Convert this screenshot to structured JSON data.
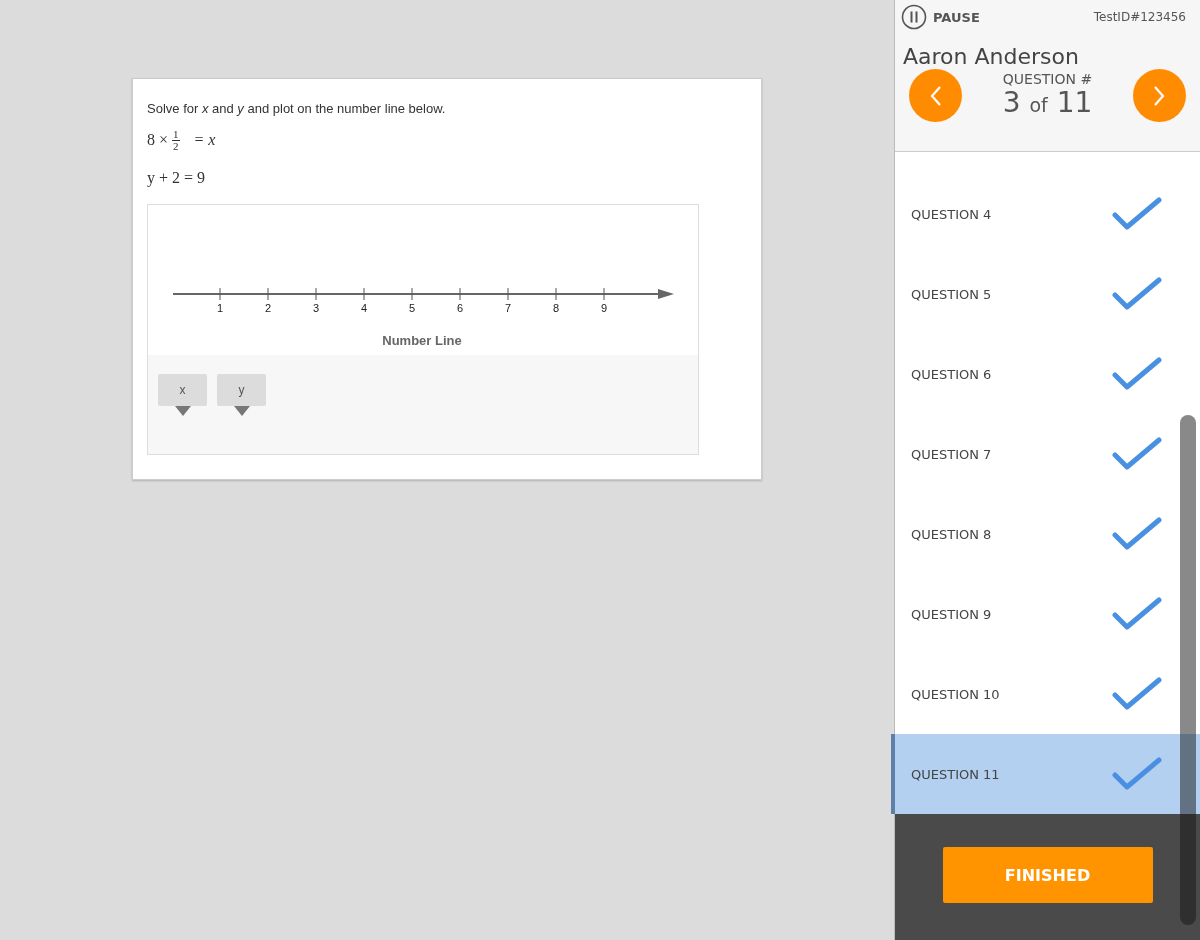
{
  "question": {
    "prompt": "Solve for *x* and *y* and plot on the number line below.",
    "equations": [
      {
        "kind": "fraction",
        "before": "8 ×",
        "numerator": "1",
        "denominator": "2",
        "after": "= x"
      },
      {
        "kind": "plain",
        "text": "y + 2 = 9"
      }
    ],
    "number_line": {
      "ticks": [
        "1",
        "2",
        "3",
        "4",
        "5",
        "6",
        "7",
        "8",
        "9"
      ],
      "caption": "Number Line"
    },
    "tokens": [
      "x",
      "y"
    ]
  },
  "sidebar": {
    "pause": "PAUSE",
    "test_id": "TestID#123456",
    "student": "Aaron Anderson",
    "question_label": "QUESTION #",
    "current": "3",
    "of": "of",
    "total": "11",
    "questions": [
      {
        "label": "QUESTION 4",
        "checked": true,
        "selected": false
      },
      {
        "label": "QUESTION 5",
        "checked": true,
        "selected": false
      },
      {
        "label": "QUESTION 6",
        "checked": true,
        "selected": false
      },
      {
        "label": "QUESTION 7",
        "checked": true,
        "selected": false
      },
      {
        "label": "QUESTION 8",
        "checked": true,
        "selected": false
      },
      {
        "label": "QUESTION 9",
        "checked": true,
        "selected": false
      },
      {
        "label": "QUESTION 10",
        "checked": true,
        "selected": false
      },
      {
        "label": "QUESTION 11",
        "checked": true,
        "selected": true
      }
    ],
    "finish": "FINISHED"
  }
}
